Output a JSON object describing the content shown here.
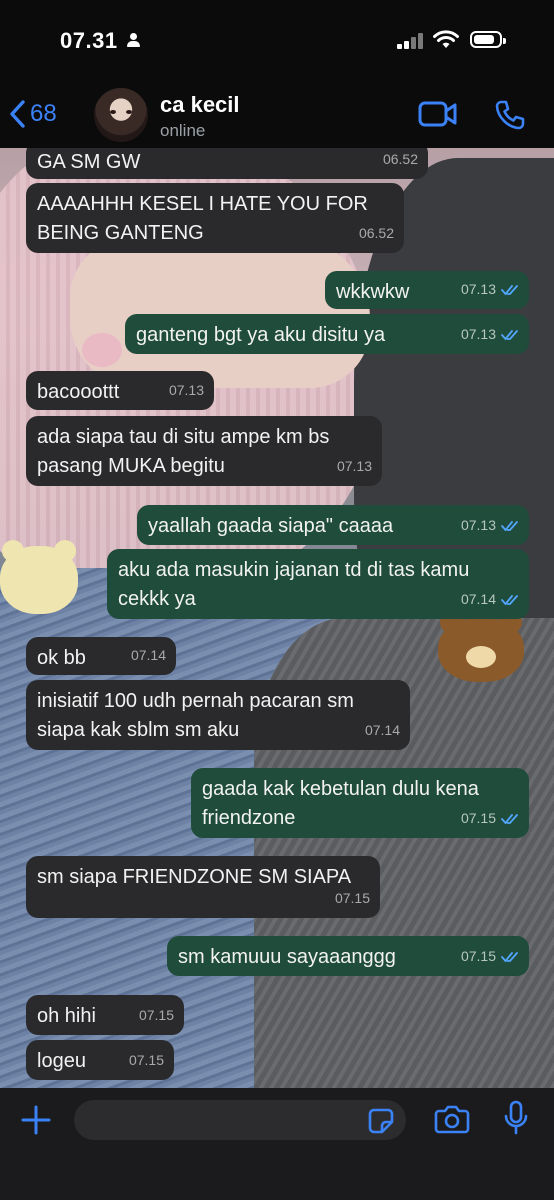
{
  "status_bar": {
    "time": "07.31"
  },
  "header": {
    "back_count": "68",
    "contact_name": "ca kecil",
    "contact_status": "online"
  },
  "messages": [
    {
      "dir": "in",
      "text": "GA SM GW",
      "time": "06.52"
    },
    {
      "dir": "in",
      "text": "AAAAHHH KESEL I HATE YOU FOR BEING GANTENG",
      "time": "06.52"
    },
    {
      "dir": "out",
      "text": "wkkwkw",
      "time": "07.13"
    },
    {
      "dir": "out",
      "text": "ganteng bgt ya aku disitu ya",
      "time": "07.13"
    },
    {
      "dir": "in",
      "text": "bacooottt",
      "time": "07.13"
    },
    {
      "dir": "in",
      "text": "ada siapa tau di situ ampe km bs pasang MUKA begitu",
      "time": "07.13"
    },
    {
      "dir": "out",
      "text": "yaallah gaada siapa\" caaaa",
      "time": "07.13"
    },
    {
      "dir": "out",
      "text": "aku ada masukin jajanan td di tas kamu cekkk ya",
      "time": "07.14"
    },
    {
      "dir": "in",
      "text": "ok bb",
      "time": "07.14"
    },
    {
      "dir": "in",
      "text": "inisiatif 100 udh pernah pacaran sm siapa kak sblm sm aku",
      "time": "07.14"
    },
    {
      "dir": "out",
      "text": "gaada kak kebetulan dulu kena friendzone",
      "time": "07.15"
    },
    {
      "dir": "in",
      "text": "sm siapa FRIENDZONE SM SIAPA",
      "time": "07.15"
    },
    {
      "dir": "out",
      "text": "sm kamuuu sayaaanggg",
      "time": "07.15"
    },
    {
      "dir": "in",
      "text": "oh hihi",
      "time": "07.15"
    },
    {
      "dir": "in",
      "text": "logeu",
      "time": "07.15"
    }
  ],
  "colors": {
    "accent": "#3b82f6",
    "incoming": "#2a2a2c",
    "outgoing": "#1f4c3b",
    "read_tick": "#53a6ff"
  },
  "icons": [
    "back-chevron-icon",
    "video-call-icon",
    "phone-icon",
    "plus-icon",
    "sticker-icon",
    "camera-icon",
    "microphone-icon",
    "double-check-icon"
  ]
}
